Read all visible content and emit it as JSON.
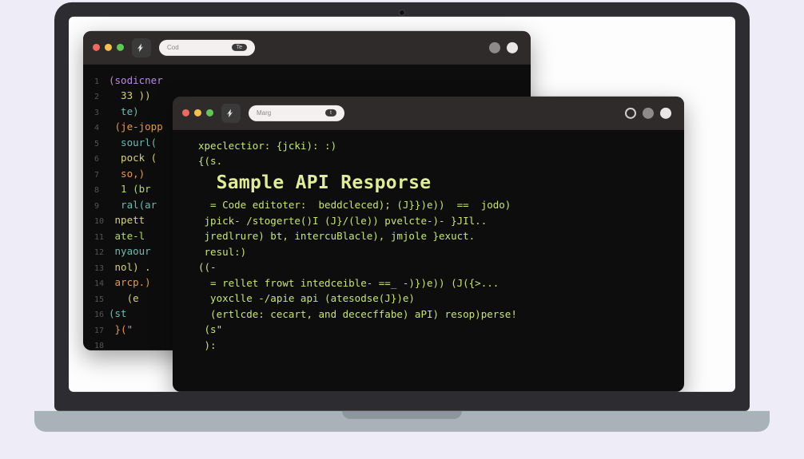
{
  "laptop": {
    "camera": true
  },
  "back_window": {
    "addr_left": "Cod",
    "addr_chip": "Te",
    "lines": [
      {
        "g": "1",
        "t": "(sodicner",
        "cls": "kw-purple"
      },
      {
        "g": "2",
        "t": "  33 ))",
        "cls": "kw-yellow"
      },
      {
        "g": "3",
        "t": "  te)",
        "cls": "kw-teal"
      },
      {
        "g": "4",
        "t": " (je-jopp",
        "cls": "kw-orange"
      },
      {
        "g": "5",
        "t": "  sourl(",
        "cls": "kw-teal"
      },
      {
        "g": "6",
        "t": "  pock (",
        "cls": "kw-yellow"
      },
      {
        "g": "7",
        "t": "  so,)",
        "cls": "kw-orange"
      },
      {
        "g": "8",
        "t": "  1 (br",
        "cls": "kw-green"
      },
      {
        "g": "9",
        "t": "  ral(ar",
        "cls": "kw-teal"
      },
      {
        "g": "10",
        "t": " npett",
        "cls": "kw-yellow"
      },
      {
        "g": "11",
        "t": " ate-l",
        "cls": "kw-green"
      },
      {
        "g": "12",
        "t": " nyaour",
        "cls": "kw-teal"
      },
      {
        "g": "13",
        "t": " nol) .",
        "cls": "kw-yellow"
      },
      {
        "g": "14",
        "t": " arcp.)",
        "cls": "kw-orange"
      },
      {
        "g": "15",
        "t": "   (e",
        "cls": "kw-yellow"
      },
      {
        "g": "16",
        "t": "(st",
        "cls": "kw-teal"
      },
      {
        "g": "17",
        "t": " }(\"",
        "cls": "kw-orange"
      },
      {
        "g": "18",
        "t": " ",
        "cls": ""
      }
    ]
  },
  "front_window": {
    "addr_left": "Marg",
    "addr_chip": "t",
    "heading": "Sample API Resporse",
    "lines_top": [
      "xpeclectior: {jcki): :)",
      "{(s."
    ],
    "lines_mid": [
      "  = Code editoter:  beddcleced); (J}})e))  ==  jodo)",
      " jpick- /stogerte()I (J}/(le)) pvelcte-)- }JIl..",
      " jredlrure) bt, intercuBlacle), jmjole }exuct.",
      " resul:)",
      "((-",
      "  = rellet frowt intedceible- ==_ -)})e)) (J({>...",
      "  yoxclle -/apie api (atesodse(J})e)",
      "  (ertlcde: cecart, and dececffabe) aPI) resop)perse!",
      " (s\"",
      " ):"
    ]
  }
}
